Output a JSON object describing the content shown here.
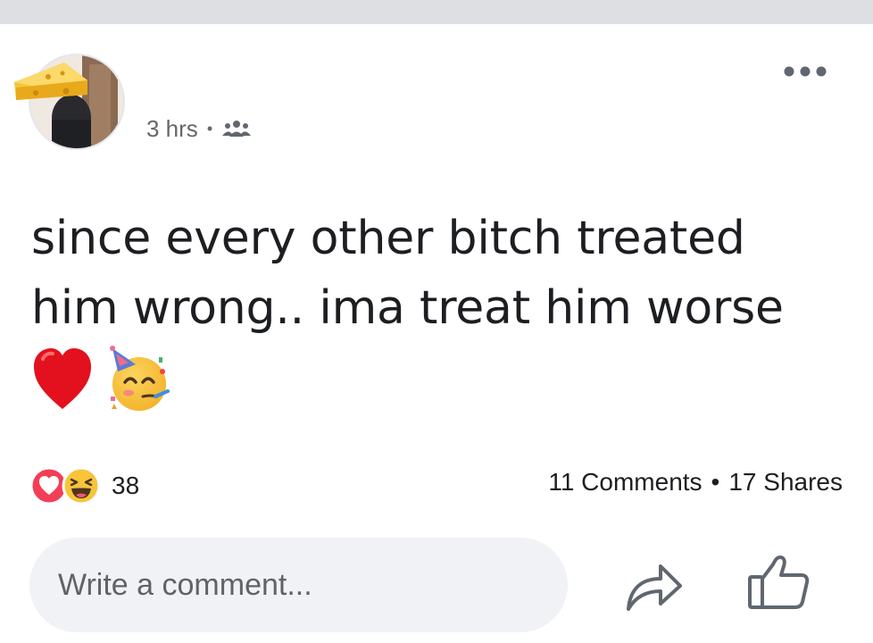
{
  "post": {
    "time": "3 hrs",
    "separator": "•",
    "audience_icon": "friends-icon",
    "more_icon": "more-options-icon",
    "text_line1": "since every other bitch treated",
    "text_line2": "him wrong.. ima treat him worse",
    "emojis": [
      "red-heart-emoji",
      "partying-face-emoji"
    ]
  },
  "engagement": {
    "reaction_icons": [
      "love-reaction-icon",
      "haha-reaction-icon"
    ],
    "reaction_count": "38",
    "comments": "11 Comments",
    "separator": "•",
    "shares": "17 Shares"
  },
  "composer": {
    "placeholder": "Write a comment...",
    "share_icon": "share-icon",
    "like_icon": "like-icon"
  },
  "colors": {
    "love": "#f33e58",
    "haha": "#f7b125",
    "topbar": "#dddfe2",
    "input_bg": "#f0f2f5"
  }
}
